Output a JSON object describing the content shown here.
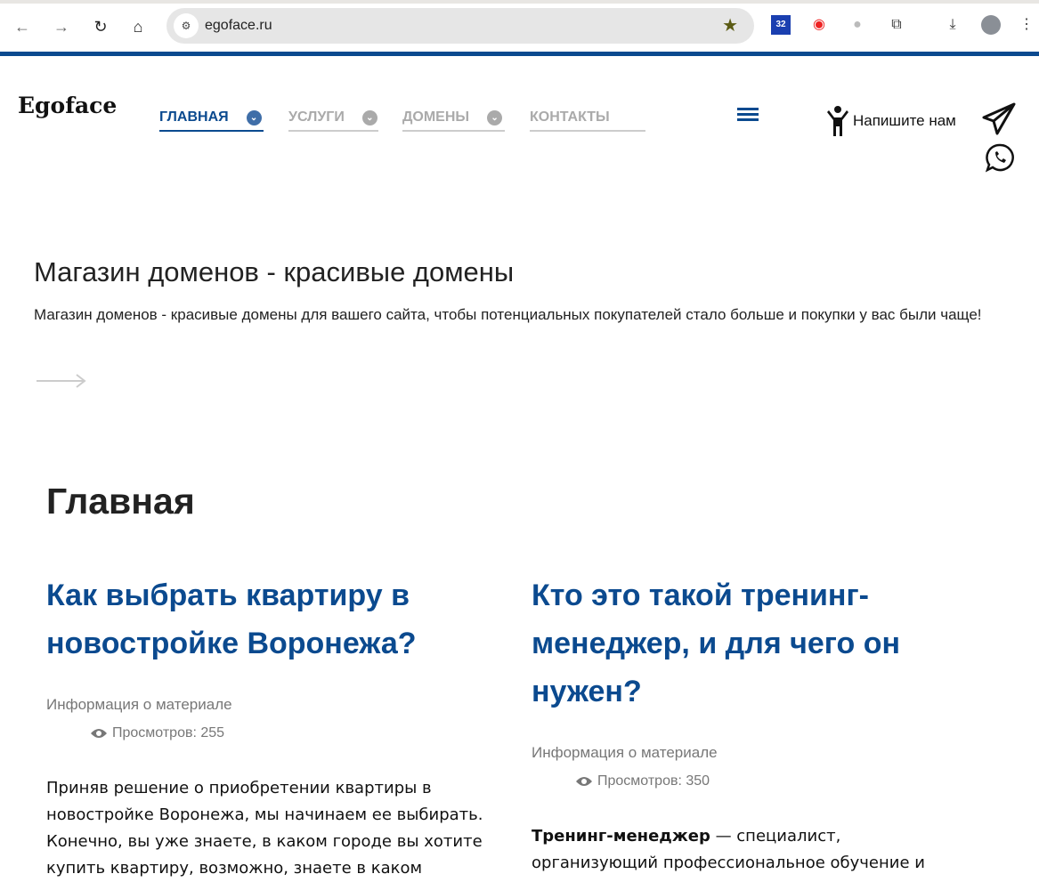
{
  "browser": {
    "url": "egoface.ru",
    "ext_badge": "32"
  },
  "site": {
    "logo": "Egoface",
    "nav": [
      {
        "label": "ГЛАВНАЯ"
      },
      {
        "label": "УСЛУГИ"
      },
      {
        "label": "ДОМЕНЫ"
      },
      {
        "label": "КОНТАКТЫ"
      }
    ],
    "write_us": "Напишите нам"
  },
  "hero": {
    "title": "Магазин доменов - красивые домены",
    "text": "Магазин доменов - красивые домены для вашего сайта, чтобы потенциальных покупателей стало больше и покупки у вас были чаще!"
  },
  "page_title": "Главная",
  "articles": [
    {
      "title": "Как выбрать квартиру в новостройке Воронежа?",
      "info": "Информация о материале",
      "views": "Просмотров: 255",
      "body_bold": "",
      "body": "Приняв решение о приобретении квартиры в новостройке Воронежа, мы начинаем ее выбирать. Конечно, вы уже знаете, в каком городе вы хотите купить квартиру, возможно, знаете в каком"
    },
    {
      "title": "Кто это такой тренинг-менеджер, и для чего он нужен?",
      "info": "Информация о материале",
      "views": "Просмотров: 350",
      "body_bold": "Тренинг-менеджер",
      "body": " — специалист, организующий профессиональное обучение и"
    }
  ]
}
